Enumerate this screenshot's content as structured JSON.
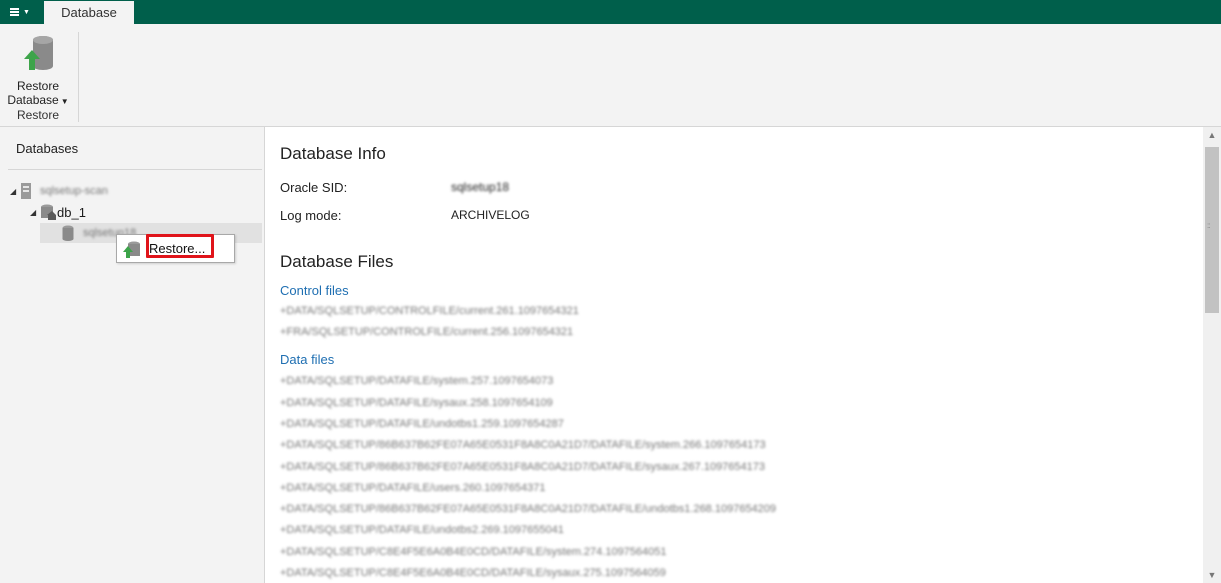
{
  "topbar": {
    "menu_icon": "hamburger-menu-icon",
    "tab_label": "Database",
    "brand_color": "#005f4b"
  },
  "ribbon": {
    "restore_button": {
      "icon": "restore-database-icon",
      "label_line1": "Restore",
      "label_line2": "Database"
    },
    "group_label": "Restore"
  },
  "sidebar": {
    "title": "Databases",
    "tree": [
      {
        "label": "sqlsetup-scan",
        "icon": "server-icon",
        "expanded": true,
        "level": 0
      },
      {
        "label": "db_1",
        "icon": "database-home-icon",
        "expanded": true,
        "level": 1
      },
      {
        "label": "sqlsetup18",
        "icon": "database-icon",
        "level": 2,
        "selected": true
      }
    ]
  },
  "context_menu": {
    "items": [
      {
        "label": "Restore...",
        "icon": "restore-icon",
        "highlighted": true
      }
    ]
  },
  "main": {
    "database_info_title": "Database Info",
    "oracle_sid_label": "Oracle SID:",
    "oracle_sid_value": "sqlsetup18",
    "log_mode_label": "Log mode:",
    "log_mode_value": "ARCHIVELOG",
    "database_files_title": "Database Files",
    "control_files_label": "Control files",
    "control_files": [
      "+DATA/SQLSETUP/CONTROLFILE/current.261.1097654321",
      "+FRA/SQLSETUP/CONTROLFILE/current.256.1097654321"
    ],
    "data_files_label": "Data files",
    "data_files": [
      "+DATA/SQLSETUP/DATAFILE/system.257.1097654073",
      "+DATA/SQLSETUP/DATAFILE/sysaux.258.1097654109",
      "+DATA/SQLSETUP/DATAFILE/undotbs1.259.1097654287",
      "+DATA/SQLSETUP/86B637B62FE07A65E0531F8A8C0A21D7/DATAFILE/system.266.1097654173",
      "+DATA/SQLSETUP/86B637B62FE07A65E0531F8A8C0A21D7/DATAFILE/sysaux.267.1097654173",
      "+DATA/SQLSETUP/DATAFILE/users.260.1097654371",
      "+DATA/SQLSETUP/86B637B62FE07A65E0531F8A8C0A21D7/DATAFILE/undotbs1.268.1097654209",
      "+DATA/SQLSETUP/DATAFILE/undotbs2.269.1097655041",
      "+DATA/SQLSETUP/C8E4F5E6A0B4E0CD/DATAFILE/system.274.1097564051",
      "+DATA/SQLSETUP/C8E4F5E6A0B4E0CD/DATAFILE/sysaux.275.1097564059"
    ]
  },
  "colors": {
    "highlight_red": "#e0141a",
    "link_blue": "#1f6fb2"
  }
}
